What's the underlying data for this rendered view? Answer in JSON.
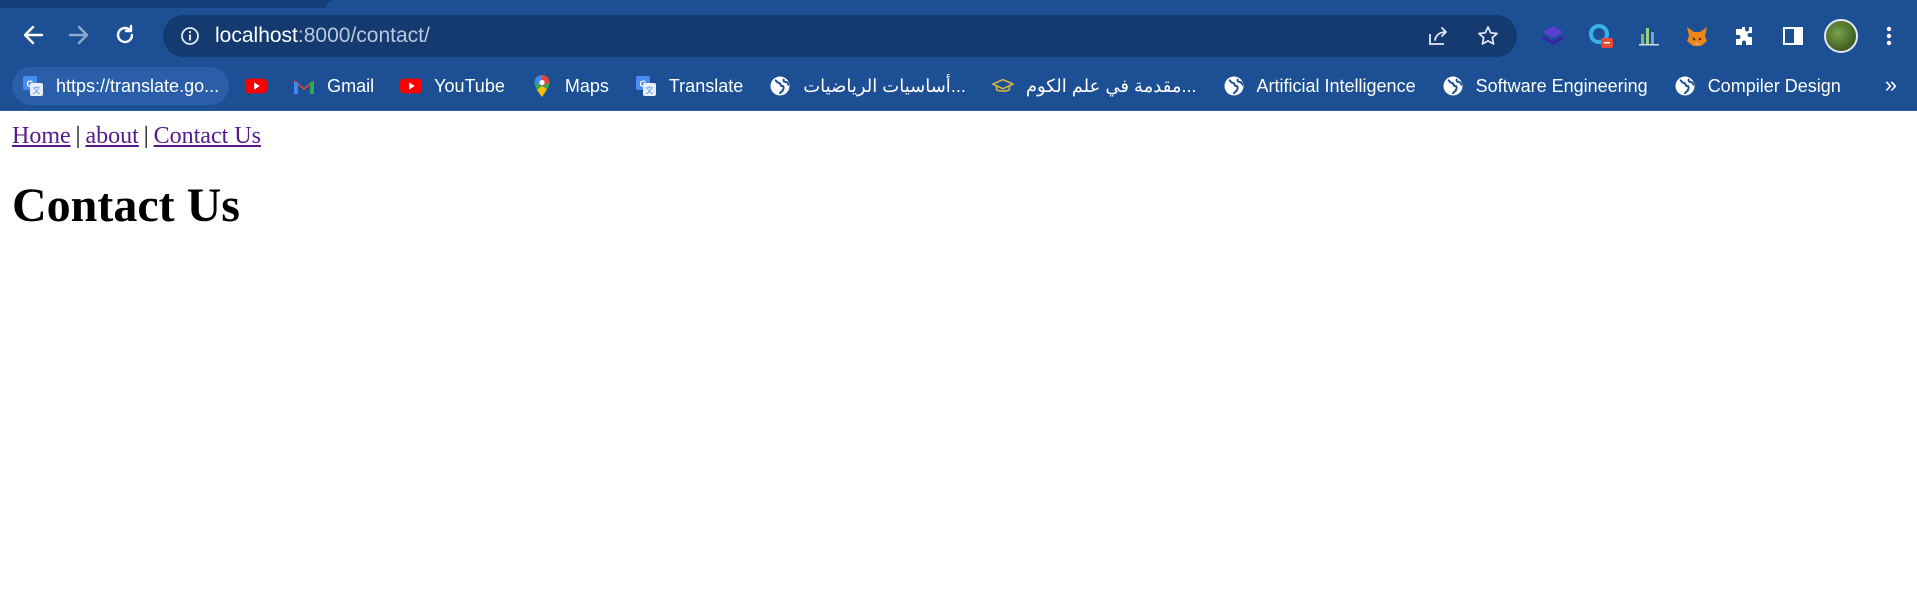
{
  "browser": {
    "url_host": "localhost",
    "url_path": ":8000/contact/",
    "bookmarks": [
      {
        "label": "https://translate.go...",
        "icon": "google-translate-icon"
      },
      {
        "label": "",
        "icon": "youtube-icon"
      },
      {
        "label": "Gmail",
        "icon": "gmail-icon"
      },
      {
        "label": "YouTube",
        "icon": "youtube-icon"
      },
      {
        "label": "Maps",
        "icon": "google-maps-icon"
      },
      {
        "label": "Translate",
        "icon": "google-translate-icon"
      },
      {
        "label": "أساسيات الرياضيات...",
        "icon": "globe-icon"
      },
      {
        "label": "مقدمة في علم الكوم...",
        "icon": "graduation-cap-icon"
      },
      {
        "label": "Artificial Intelligence",
        "icon": "globe-icon"
      },
      {
        "label": "Software Engineering",
        "icon": "globe-icon"
      },
      {
        "label": "Compiler Design",
        "icon": "globe-icon"
      }
    ],
    "more_bookmarks": "»",
    "colors": {
      "chrome_bg": "#1c4f93",
      "omnibox_bg": "#143a6f",
      "visited_link": "#551a8b"
    }
  },
  "page": {
    "nav": {
      "home": "Home",
      "about": "about",
      "contact": "Contact Us",
      "separator": "|"
    },
    "heading": "Contact Us"
  }
}
